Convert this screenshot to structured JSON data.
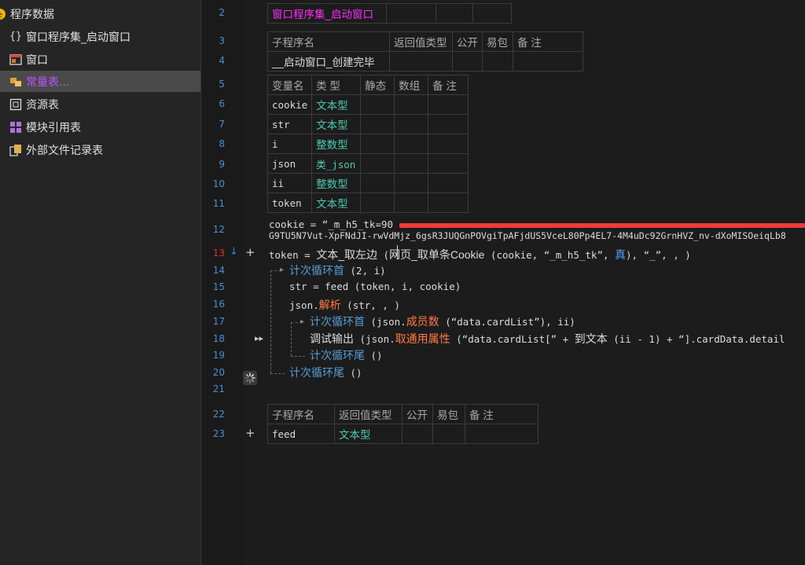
{
  "sidebar": {
    "items": [
      {
        "label": "程序数据",
        "icon": "program-data-icon"
      },
      {
        "label": "窗口程序集_启动窗口",
        "icon": "braces-icon"
      },
      {
        "label": "窗口",
        "icon": "window-icon"
      },
      {
        "label": "常量表...",
        "icon": "constant-table-icon"
      },
      {
        "label": "资源表",
        "icon": "resource-table-icon"
      },
      {
        "label": "模块引用表",
        "icon": "module-ref-icon"
      },
      {
        "label": "外部文件记录表",
        "icon": "external-file-icon"
      }
    ]
  },
  "line_numbers": [
    "2",
    "3",
    "4",
    "5",
    "6",
    "7",
    "8",
    "9",
    "10",
    "11",
    "12",
    "13",
    "14",
    "15",
    "16",
    "17",
    "18",
    "19",
    "20",
    "21",
    "22",
    "23"
  ],
  "table_assembly": {
    "name": "窗口程序集_启动窗口"
  },
  "table_sub1": {
    "headers": [
      "子程序名",
      "返回值类型",
      "公开",
      "易包",
      "备 注"
    ],
    "row": [
      "__启动窗口_创建完毕",
      "",
      "",
      "",
      ""
    ]
  },
  "table_vars": {
    "headers": [
      "变量名",
      "类 型",
      "静态",
      "数组",
      "备 注"
    ],
    "rows": [
      [
        "cookie",
        "文本型"
      ],
      [
        "str",
        "文本型"
      ],
      [
        "i",
        "整数型"
      ],
      [
        "json",
        "类_json"
      ],
      [
        "ii",
        "整数型"
      ],
      [
        "token",
        "文本型"
      ]
    ]
  },
  "code": {
    "l12a": "cookie = “_m_h5_tk=90",
    "l12b": "G9TU5N7Vut-XpFNdJI-rwVdMjz_6gsR3JUQGnPOVgiTpAFjdUS5VceL80Pp4EL7-4M4uDc92GrnHVZ_nv-dXoMISOeiqLb8",
    "l13_a": "token = ",
    "l13_fn1": "文本_取左边",
    "l13_b": " (",
    "l13_fn2": "网页_取单条Cookie",
    "l13_c": " (cookie, “_m_h5_tk”, ",
    "l13_true": "真",
    "l13_d": "), “_”, , )",
    "l14_kw": "计次循环首",
    "l14_args": " (2, i)",
    "l15": "str = feed (token, i, cookie)",
    "l16_a": "json.",
    "l16_fn": "解析",
    "l16_b": " (str, , )",
    "l17_kw": "计次循环首",
    "l17_a": " (json.",
    "l17_fn": "成员数",
    "l17_b": " (“data.cardList”), ii)",
    "l18_cn": "调试输出",
    "l18_a": " (json.",
    "l18_fn": "取通用属性",
    "l18_b": " (“data.cardList[” + ",
    "l18_cn2": "到文本",
    "l18_c": " (ii - 1) + “].cardData.detail",
    "l19_kw": "计次循环尾",
    "l19_args": " ()",
    "l20_kw": "计次循环尾",
    "l20_args": " ()"
  },
  "table_sub2": {
    "headers": [
      "子程序名",
      "返回值类型",
      "公开",
      "易包",
      "备 注"
    ],
    "row": [
      "feed",
      "文本型",
      "",
      "",
      ""
    ]
  },
  "colors": {
    "keyword": "#569cd6",
    "type": "#4ec9b0",
    "method": "#ff7a45",
    "assembly": "#ff2cff",
    "selection_text": "#c050ff",
    "redaction": "#f03a3a"
  }
}
